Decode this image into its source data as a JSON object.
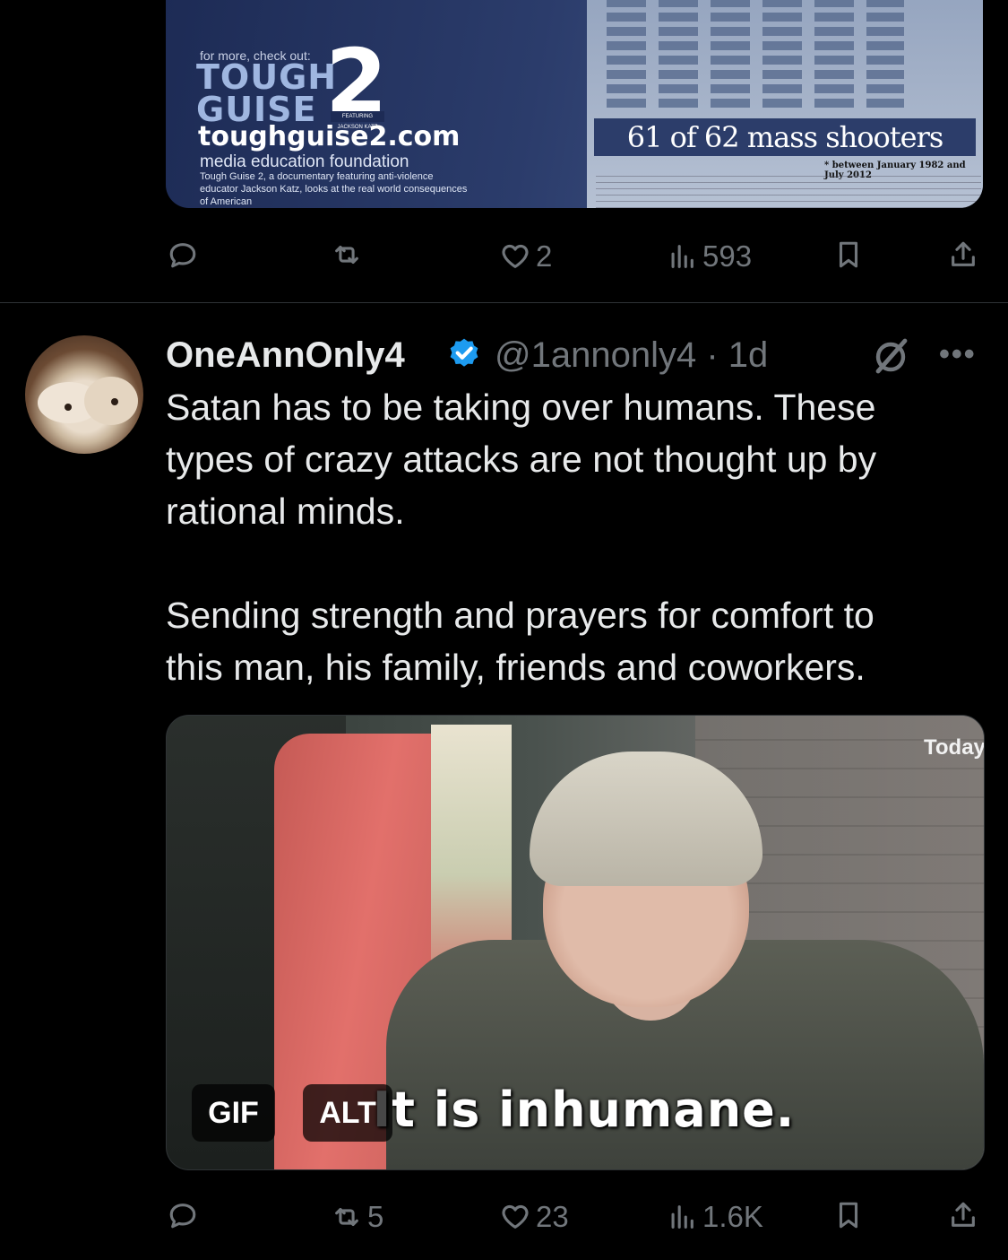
{
  "tweet1": {
    "media": {
      "checkout": "for more, check out:",
      "logo_tough": "TOUGH",
      "logo_guise": "GUISE",
      "logo_number": "2",
      "logo_tag": "FEATURING JACKSON KATZ",
      "site": "toughguise2.com",
      "org": "media education foundation",
      "description": "Tough Guise 2, a documentary featuring anti-violence educator Jackson Katz, looks at the real world consequences of American",
      "stat": "61 of 62 mass shooters",
      "date_range": "* between January 1982 and July 2012"
    },
    "actions": {
      "reply": "",
      "retweet": "",
      "like": "2",
      "views": "593"
    }
  },
  "tweet2": {
    "name": "OneAnnOnly4",
    "handle": "@1annonly4 · 1d",
    "more": "•••",
    "text_lines": [
      "Satan has to be taking over humans. These",
      "types of crazy attacks are not thought up by",
      "rational minds.",
      "Sending strength and prayers for comfort to",
      "this man, his family, friends and coworkers."
    ],
    "media": {
      "watermark": "Today",
      "caption": "It is inhumane.",
      "gif_badge": "GIF",
      "alt_badge": "ALT"
    },
    "actions": {
      "reply": "",
      "retweet": "5",
      "like": "23",
      "views": "1.6K"
    }
  },
  "icons": {
    "reply": "speech-bubble-icon",
    "retweet": "retweet-icon",
    "like": "heart-icon",
    "views": "bar-chart-icon",
    "bookmark": "bookmark-icon",
    "share": "share-upload-icon",
    "verified": "verified-badge-icon",
    "grok": "grok-icon"
  },
  "colors": {
    "background": "#000000",
    "text": "#e7e9ea",
    "muted": "#71767b",
    "verified": "#1d9bf0",
    "divider": "#2f3336"
  }
}
